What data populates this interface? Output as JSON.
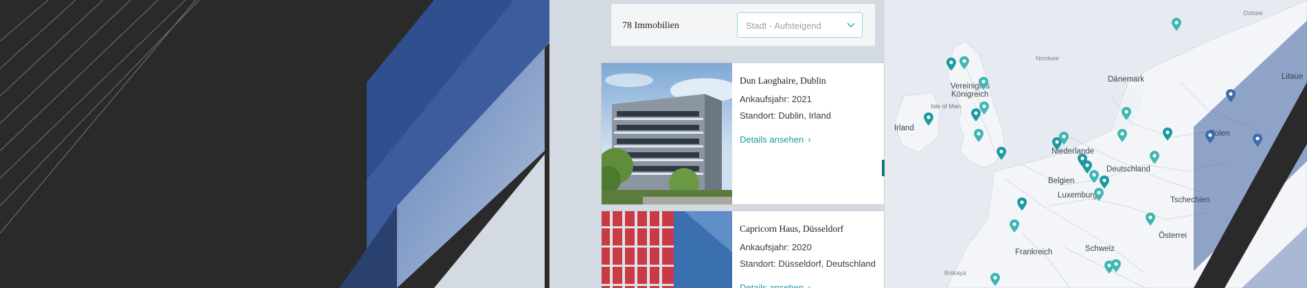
{
  "listing": {
    "count_label": "78 Immobilien",
    "sort": {
      "placeholder": "Stadt - Aufsteigend"
    }
  },
  "properties": [
    {
      "title": "Dun Laoghaire, Dublin",
      "purchase_year": "Ankaufsjahr: 2021",
      "location": "Standort: Dublin, Irland",
      "details_label": "Details ansehen"
    },
    {
      "title": "Capricorn Haus, Düsseldorf",
      "purchase_year": "Ankaufsjahr: 2020",
      "location": "Standort: Düsseldorf, Deutschland",
      "details_label": "Details ansehen"
    }
  ],
  "map": {
    "labels": {
      "ostsee": "Ostsee",
      "nordsee": "Nordsee",
      "vk1": "Vereinigtes",
      "vk2": "Königreich",
      "isle_of_man": "Isle of Man",
      "irland": "Irland",
      "daenemark": "Dänemark",
      "niederlande": "Niederlande",
      "deutschland": "Deutschland",
      "belgien": "Belgien",
      "luxemburg": "Luxemburg",
      "polen": "Polen",
      "litauen": "Litaue",
      "tschechien": "Tschechien",
      "frankreich": "Frankreich",
      "schweiz": "Schweiz",
      "oesterreich": "Österrei",
      "biskaya": "Biskaya"
    }
  },
  "colors": {
    "accent_teal": "#1a9a9e",
    "pin_teal": "#3fb6b3",
    "blue_decor": "#2f4f8f",
    "dark_bg": "#2a2a2a"
  }
}
